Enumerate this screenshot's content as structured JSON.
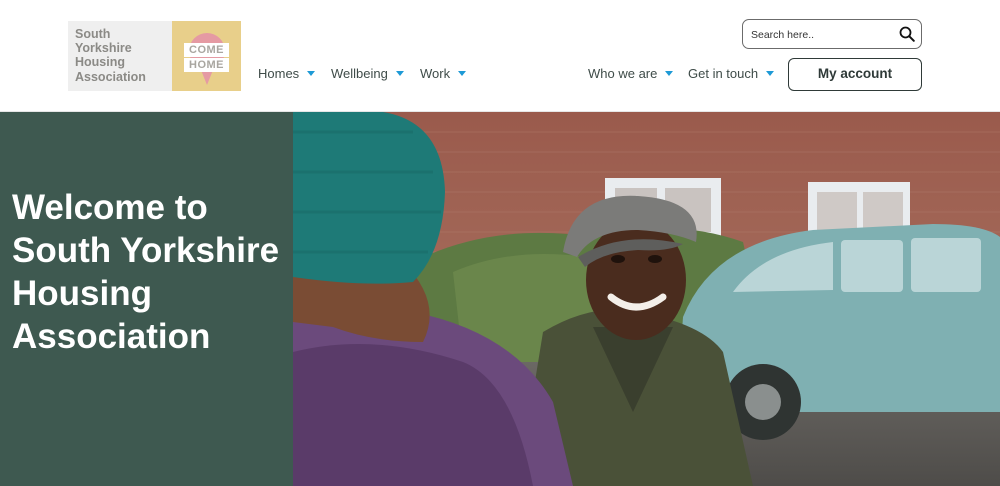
{
  "brand": {
    "name_lines": [
      "South",
      "Yorkshire",
      "Housing",
      "Association"
    ],
    "badge_words": [
      "COME",
      "HOME"
    ]
  },
  "nav": {
    "primary": [
      {
        "label": "Homes"
      },
      {
        "label": "Wellbeing"
      },
      {
        "label": "Work"
      }
    ],
    "secondary": [
      {
        "label": "Who we are"
      },
      {
        "label": "Get in touch"
      }
    ]
  },
  "search": {
    "placeholder": "Search here.."
  },
  "account": {
    "label": "My account"
  },
  "hero": {
    "title": "Welcome to South Yorkshire Housing Association"
  },
  "icons": {
    "search": "search-icon",
    "nav_caret": "caret-down-icon",
    "logo_pin": "map-pin-icon"
  },
  "colors": {
    "accent_caret": "#1e9ad6",
    "hero_panel": "#3e5950",
    "logo_badge": "#e8cf8a",
    "logo_pin": "#e59aa3"
  }
}
